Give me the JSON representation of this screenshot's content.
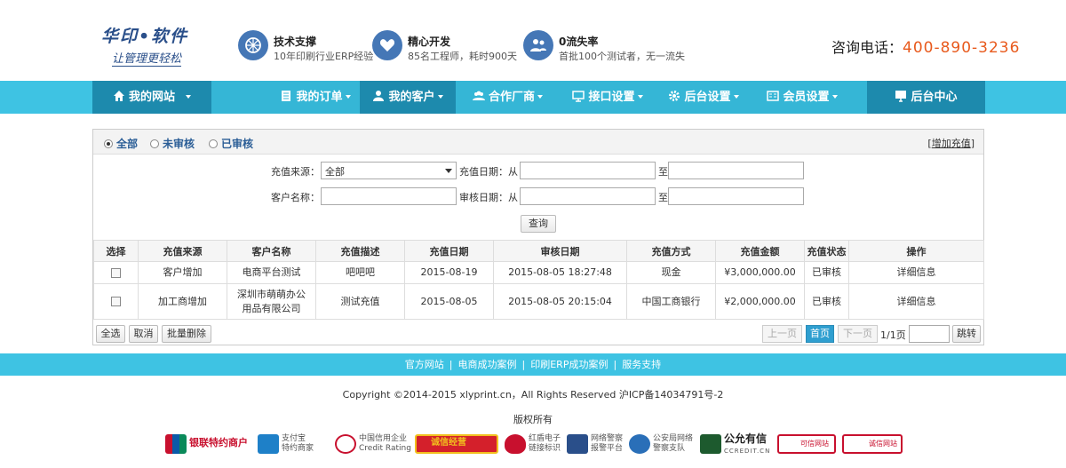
{
  "header": {
    "logo_line1": "华印•软件",
    "logo_line2": "让管理更轻松",
    "features": [
      {
        "title": "技术支撑",
        "desc": "10年印刷行业ERP经验"
      },
      {
        "title": "精心开发",
        "desc": "85名工程师，耗时900天"
      },
      {
        "title": "0流失率",
        "desc": "首批100个测试者，无一流失"
      }
    ],
    "hotline_label": "咨询电话：",
    "hotline_number": "400-890-3236"
  },
  "nav": {
    "items": [
      {
        "label": "我的网站",
        "icon": "home-icon"
      },
      {
        "label": "我的订单",
        "icon": "document-icon"
      },
      {
        "label": "我的客户",
        "icon": "user-icon"
      },
      {
        "label": "合作厂商",
        "icon": "group-icon"
      },
      {
        "label": "接口设置",
        "icon": "monitor-icon"
      },
      {
        "label": "后台设置",
        "icon": "gear-icon"
      },
      {
        "label": "会员设置",
        "icon": "member-card-icon"
      },
      {
        "label": "后台中心",
        "icon": "desktop-icon"
      }
    ]
  },
  "filters": {
    "status_options": [
      "全部",
      "未审核",
      "已审核"
    ],
    "selected_status": "全部",
    "add_link": "增加充值",
    "source_label": "充值来源：",
    "source_value": "全部",
    "date_label": "充值日期：从",
    "to_label": "至",
    "customer_label": "客户名称：",
    "audit_date_label": "审核日期：从",
    "search_button": "查询"
  },
  "table": {
    "headers": [
      "选择",
      "充值来源",
      "客户名称",
      "充值描述",
      "充值日期",
      "审核日期",
      "充值方式",
      "充值金额",
      "充值状态",
      "操作"
    ],
    "rows": [
      {
        "source": "客户增加",
        "customer": "电商平台测试",
        "desc": "吧吧吧",
        "date": "2015-08-19",
        "audit": "2015-08-05 18:27:48",
        "method": "现金",
        "amount": "¥3,000,000.00",
        "status": "已审核",
        "action": "详细信息"
      },
      {
        "source": "加工商增加",
        "customer": "深圳市萌萌办公用品有限公司",
        "desc": "测试充值",
        "date": "2015-08-05",
        "audit": "2015-08-05 20:15:04",
        "method": "中国工商银行",
        "amount": "¥2,000,000.00",
        "status": "已审核",
        "action": "详细信息"
      }
    ]
  },
  "actions": {
    "select_all": "全选",
    "cancel": "取消",
    "bulk_delete": "批量删除"
  },
  "pager": {
    "prev": "上一页",
    "first": "首页",
    "next": "下一页",
    "info": "1/1页",
    "jump": "跳转"
  },
  "footer": {
    "links": [
      "官方网站",
      "电商成功案例",
      "印刷ERP成功案例",
      "服务支持"
    ],
    "separator": "|",
    "copyright": "Copyright ©2014-2015 xlyprint.cn，All Rights Reserved 沪ICP备14034791号-2",
    "rights": "版权所有",
    "badges": [
      {
        "line1": "银联特约商户",
        "line2": "",
        "color": "#c8102e",
        "icon": "unionpay-icon"
      },
      {
        "line1": "支付宝",
        "line2": "特约商家",
        "color": "#1e80c8",
        "icon": "alipay-icon"
      },
      {
        "line1": "中国信用企业",
        "line2": "Credit Rating",
        "color": "#c8102e",
        "icon": "credit-icon"
      },
      {
        "line1": "诚信经营",
        "line2": "",
        "color": "#d4202b",
        "icon": "honest-icon"
      },
      {
        "line1": "红盾电子",
        "line2": "链接标识",
        "color": "#c8102e",
        "icon": "red-shield-icon"
      },
      {
        "line1": "网络警察",
        "line2": "报警平台",
        "color": "#2a4f8a",
        "icon": "police-icon"
      },
      {
        "line1": "公安局网络",
        "line2": "警察支队",
        "color": "#2a6fb8",
        "icon": "police-badge-icon"
      },
      {
        "line1": "公允有信",
        "line2": "CCREDIT.CN",
        "color": "#1d5a2e",
        "icon": "ccredit-icon"
      },
      {
        "line1": "可信网站",
        "line2": "",
        "color": "#c8102e",
        "icon": "trusted-icon"
      },
      {
        "line1": "诚信网站",
        "line2": "",
        "color": "#c8102e",
        "icon": "integrity-icon"
      }
    ]
  }
}
